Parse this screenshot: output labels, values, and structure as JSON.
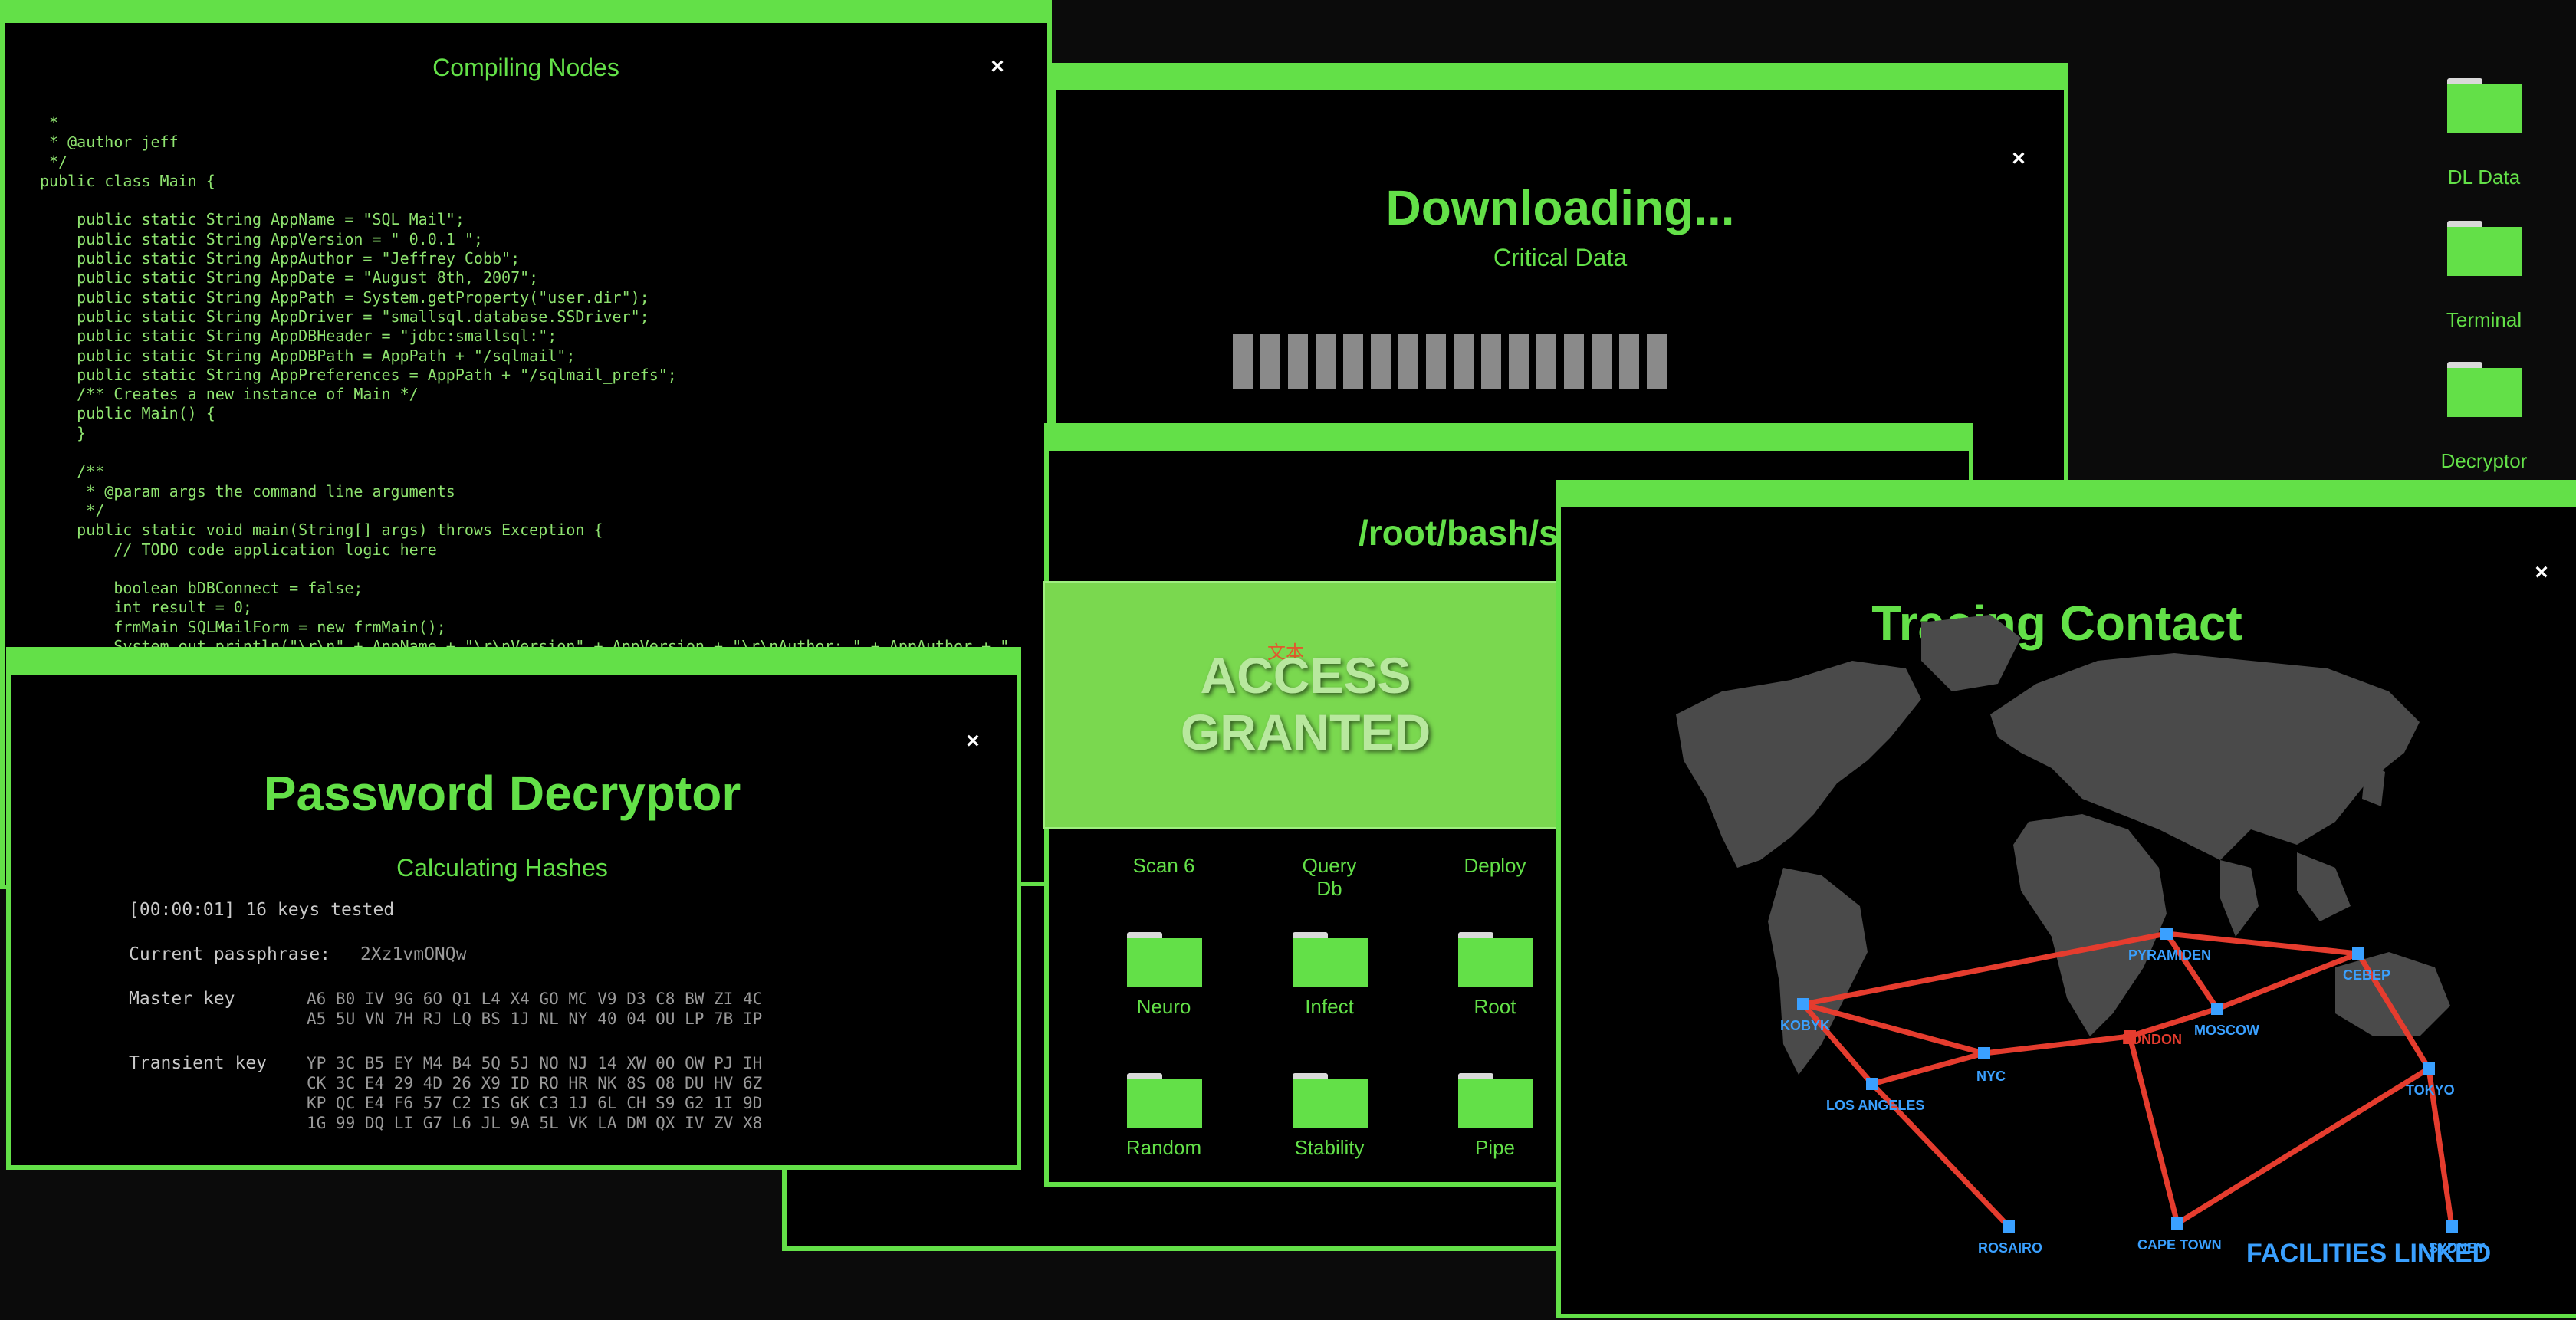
{
  "code_window": {
    "title": "Compiling Nodes",
    "code": " *\n * @author jeff\n */\npublic class Main {\n\n    public static String AppName = \"SQL Mail\";\n    public static String AppVersion = \" 0.0.1 \";\n    public static String AppAuthor = \"Jeffrey Cobb\";\n    public static String AppDate = \"August 8th, 2007\";\n    public static String AppPath = System.getProperty(\"user.dir\");\n    public static String AppDriver = \"smallsql.database.SSDriver\";\n    public static String AppDBHeader = \"jdbc:smallsql:\";\n    public static String AppDBPath = AppPath + \"/sqlmail\";\n    public static String AppPreferences = AppPath + \"/sqlmail_prefs\";\n    /** Creates a new instance of Main */\n    public Main() {\n    }\n\n    /**\n     * @param args the command line arguments\n     */\n    public static void main(String[] args) throws Exception {\n        // TODO code application logic here\n\n        boolean bDBConnect = false;\n        int result = 0;\n        frmMain SQLMailForm = new frmMain();\n        System.out.println(\"\\r\\n\" + AppName + \"\\r\\nVersion\" + AppVersion + \"\\r\\nAuthor: \" + AppAuthor + \""
  },
  "download_window": {
    "title": "Downloading...",
    "subtitle": "Critical Data",
    "progress_segments": 16
  },
  "desktop_icons": [
    {
      "label": "DL Data"
    },
    {
      "label": "Terminal"
    },
    {
      "label": "Decryptor"
    }
  ],
  "terminal_window": {
    "title": "/root/bash/s"
  },
  "access_banner": {
    "line1": "ACCESS",
    "line2": "GRANTED",
    "watermark": "文本"
  },
  "folder_grid": [
    {
      "label": "Scan 6"
    },
    {
      "label": "Query\nDb"
    },
    {
      "label": "Deploy"
    },
    {
      "label": "Neuro"
    },
    {
      "label": "Infect"
    },
    {
      "label": "Root"
    },
    {
      "label": "Random"
    },
    {
      "label": "Stability"
    },
    {
      "label": "Pipe"
    }
  ],
  "password_window": {
    "title": "Password Decryptor",
    "subtitle": "Calculating Hashes",
    "keys_line": "[00:00:01] 16 keys tested",
    "passphrase_label": "Current passphrase:",
    "passphrase_value": "2Xz1vmONQw",
    "master_label": "Master key",
    "master_lines": [
      "A6 B0 IV 9G 6O Q1 L4 X4 GO MC V9 D3 C8 BW ZI 4C",
      "A5 5U VN 7H RJ LQ BS 1J NL NY 40 04 OU LP 7B IP"
    ],
    "transient_label": "Transient key",
    "transient_lines": [
      "YP 3C B5 EY M4 B4 5Q 5J NO NJ 14 XW 0O OW PJ IH",
      "CK 3C E4 29 4D 26 X9 ID RO HR NK 8S O8 DU HV 6Z",
      "KP QC E4 F6 57 C2 IS GK C3 1J 6L CH S9 G2 1I 9D",
      "1G 99 DQ LI G7 L6 JL 9A 5L VK LA DM QX IV ZV X8"
    ]
  },
  "trace_window": {
    "title": "Tracing Contact",
    "footer": "FACILITIES LINKED",
    "cities": [
      {
        "name": "KOBYK",
        "color": "#3aa0ff"
      },
      {
        "name": "PYRAMIDEN",
        "color": "#3aa0ff"
      },
      {
        "name": "CEBEP",
        "color": "#3aa0ff"
      },
      {
        "name": "MOSCOW",
        "color": "#3aa0ff"
      },
      {
        "name": "LONDON",
        "color": "#e53c2e"
      },
      {
        "name": "NYC",
        "color": "#3aa0ff"
      },
      {
        "name": "LOS ANGELES",
        "color": "#3aa0ff"
      },
      {
        "name": "TOKYO",
        "color": "#3aa0ff"
      },
      {
        "name": "ROSAIRO",
        "color": "#3aa0ff"
      },
      {
        "name": "CAPE TOWN",
        "color": "#3aa0ff"
      },
      {
        "name": "SYDNEY",
        "color": "#3aa0ff"
      }
    ]
  },
  "colors": {
    "accent": "#63e048",
    "route": "#e53c2e",
    "city": "#3aa0ff",
    "land": "#4a4a4a"
  }
}
